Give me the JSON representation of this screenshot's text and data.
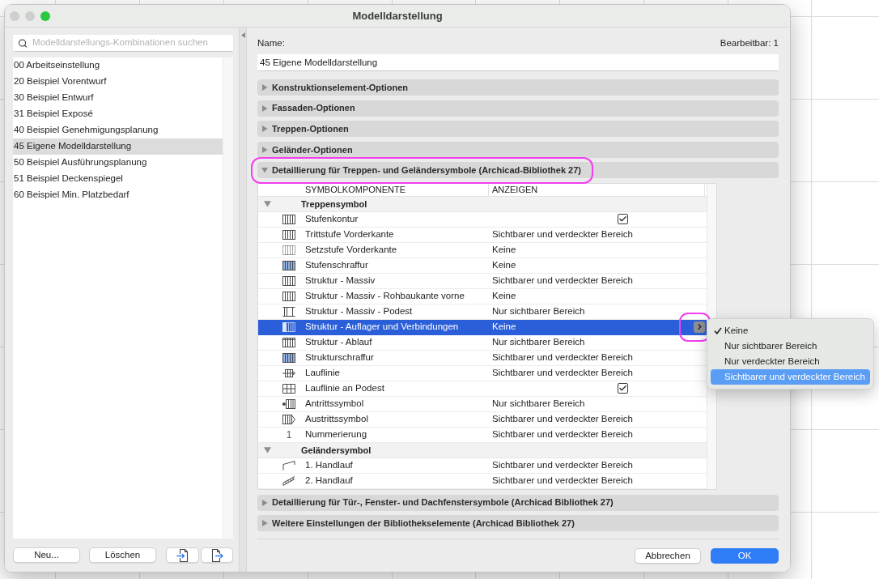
{
  "window": {
    "title": "Modelldarstellung",
    "controls": [
      {
        "kind": "close",
        "active": false
      },
      {
        "kind": "minimize",
        "active": false
      },
      {
        "kind": "zoom",
        "active": true
      }
    ]
  },
  "sidebar": {
    "search": {
      "placeholder": "Modelldarstellungs-Kombinationen suchen"
    },
    "items": [
      {
        "label": "00 Arbeitseinstellung",
        "selected": false
      },
      {
        "label": "20 Beispiel Vorentwurf",
        "selected": false
      },
      {
        "label": "30 Beispiel Entwurf",
        "selected": false
      },
      {
        "label": "31 Beispiel Exposé",
        "selected": false
      },
      {
        "label": "40 Beispiel Genehmigungsplanung",
        "selected": false
      },
      {
        "label": "45 Eigene Modelldarstellung",
        "selected": true
      },
      {
        "label": "50 Beispiel Ausführungsplanung",
        "selected": false
      },
      {
        "label": "51 Beispiel Deckenspiegel",
        "selected": false
      },
      {
        "label": "60 Beispiel Min. Platzbedarf",
        "selected": false
      }
    ],
    "buttons": [
      {
        "kind": "text",
        "label": "Neu..."
      },
      {
        "kind": "text",
        "label": "Löschen"
      },
      {
        "kind": "import"
      },
      {
        "kind": "export"
      }
    ]
  },
  "form": {
    "name_label": "Name:",
    "name_value": "45 Eigene Modelldarstellung",
    "editable": "Bearbeitbar: 1"
  },
  "sections": [
    {
      "title": "Konstruktionselement-Optionen",
      "expanded": false,
      "annotated": false
    },
    {
      "title": "Fassaden-Optionen",
      "expanded": false,
      "annotated": false
    },
    {
      "title": "Treppen-Optionen",
      "expanded": false,
      "annotated": false
    },
    {
      "title": "Geländer-Optionen",
      "expanded": false,
      "annotated": false
    },
    {
      "title": "Detaillierung für Treppen- und Geländersymbole (Archicad-Bibliothek 27)",
      "expanded": true,
      "annotated": true,
      "table": {
        "columns": [
          "SYMBOLKOMPONENTE",
          "ANZEIGEN"
        ],
        "groups": [
          {
            "label": "Treppensymbol",
            "expanded": true,
            "rows": [
              {
                "name": "Stufenkontur",
                "kind": "checkbox",
                "checked": true,
                "selected": false
              },
              {
                "name": "Trittstufe Vorderkante",
                "kind": "choice",
                "value": "Sichtbarer und verdeckter Bereich",
                "selected": false
              },
              {
                "name": "Setzstufe Vorderkante",
                "kind": "choice",
                "value": "Keine",
                "selected": false
              },
              {
                "name": "Stufenschraffur",
                "kind": "choice",
                "value": "Keine",
                "selected": false
              },
              {
                "name": "Struktur - Massiv",
                "kind": "choice",
                "value": "Sichtbarer und verdeckter Bereich",
                "selected": false
              },
              {
                "name": "Struktur - Massiv - Rohbaukante vorne",
                "kind": "choice",
                "value": "Keine",
                "selected": false
              },
              {
                "name": "Struktur - Massiv - Podest",
                "kind": "choice",
                "value": "Nur sichtbarer Bereich",
                "selected": false
              },
              {
                "name": "Struktur - Auflager und Verbindungen",
                "kind": "choice",
                "value": "Keine",
                "selected": true
              },
              {
                "name": "Struktur - Ablauf",
                "kind": "choice",
                "value": "Nur sichtbarer Bereich",
                "selected": false
              },
              {
                "name": "Strukturschraffur",
                "kind": "choice",
                "value": "Sichtbarer und verdeckter Bereich",
                "selected": false
              },
              {
                "name": "Lauflinie",
                "kind": "choice",
                "value": "Sichtbarer und verdeckter Bereich",
                "selected": false
              },
              {
                "name": "Lauflinie an Podest",
                "kind": "checkbox",
                "checked": true,
                "selected": false
              },
              {
                "name": "Antrittssymbol",
                "kind": "choice",
                "value": "Nur sichtbarer Bereich",
                "selected": false
              },
              {
                "name": "Austrittssymbol",
                "kind": "choice",
                "value": "Sichtbarer und verdeckter Bereich",
                "selected": false
              },
              {
                "name": "Nummerierung",
                "symbol": "1",
                "kind": "choice",
                "value": "Sichtbarer und verdeckter Bereich",
                "selected": false
              }
            ]
          },
          {
            "label": "Geländersymbol",
            "expanded": true,
            "rows": [
              {
                "name": "1. Handlauf",
                "kind": "choice",
                "value": "Sichtbarer und verdeckter Bereich",
                "selected": false
              },
              {
                "name": "2. Handlauf",
                "kind": "choice",
                "value": "Sichtbarer und verdeckter Bereich",
                "selected": false
              }
            ]
          }
        ],
        "popup": {
          "annotated": true,
          "options": [
            {
              "label": "Keine",
              "checked": true,
              "selected": false
            },
            {
              "label": "Nur sichtbarer Bereich",
              "checked": false,
              "selected": false
            },
            {
              "label": "Nur verdeckter Bereich",
              "checked": false,
              "selected": false
            },
            {
              "label": "Sichtbarer und verdeckter Bereich",
              "checked": false,
              "selected": true
            }
          ]
        }
      }
    },
    {
      "title": "Detaillierung für Tür-, Fenster- und Dachfenstersymbole (Archicad Bibliothek 27)",
      "expanded": false,
      "annotated": false
    },
    {
      "title": "Weitere Einstellungen der Bibliothekselemente (Archicad Bibliothek 27)",
      "expanded": false,
      "annotated": false
    }
  ],
  "footer_buttons": [
    {
      "label": "Abbrechen",
      "default": false
    },
    {
      "label": "OK",
      "default": true
    }
  ]
}
